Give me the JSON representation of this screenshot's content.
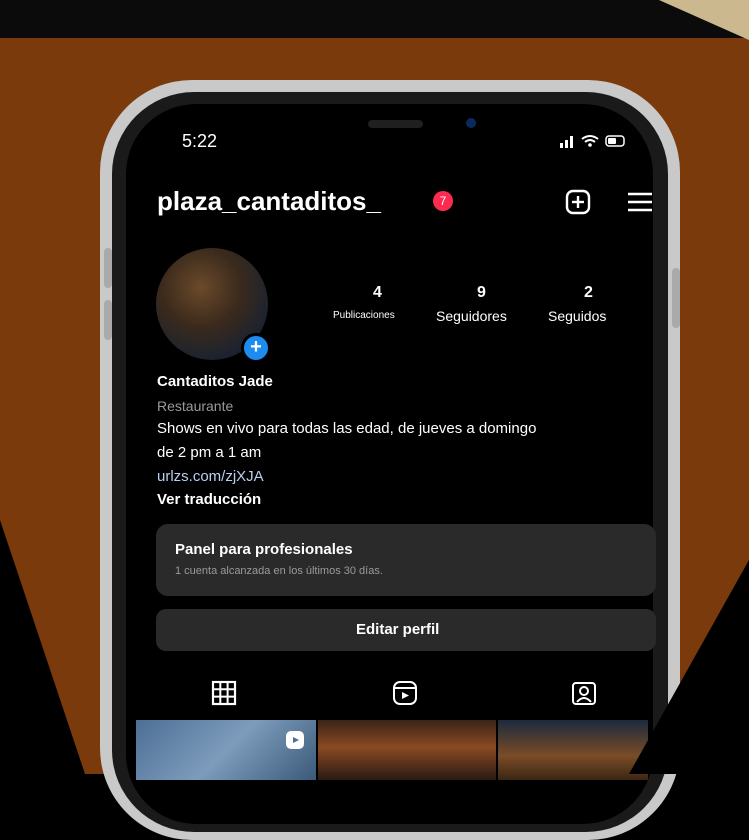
{
  "status_bar": {
    "time": "5:22"
  },
  "profile": {
    "username": "plaza_cantaditos_",
    "notification_count": "7",
    "stats": [
      {
        "value": "4",
        "label": "Publicaciones"
      },
      {
        "value": "9",
        "label": "Seguidores"
      },
      {
        "value": "2",
        "label": "Seguidos"
      }
    ],
    "name": "Cantaditos Jade",
    "category": "Restaurante",
    "bio_line1": "Shows en vivo para todas las edad, de jueves a domingo",
    "bio_line2": "de 2 pm a 1 am",
    "link": "urlzs.com/zjXJA",
    "translate": "Ver traducción"
  },
  "dashboard": {
    "title": "Panel para profesionales",
    "subtitle": "1 cuenta alcanzada en los últimos 30 días."
  },
  "edit_button": "Editar perfil",
  "icons": {
    "new_post": "plus-square-icon",
    "menu": "hamburger-menu-icon",
    "grid_tab": "grid-icon",
    "reels_tab": "reels-icon",
    "tagged_tab": "tagged-icon"
  }
}
